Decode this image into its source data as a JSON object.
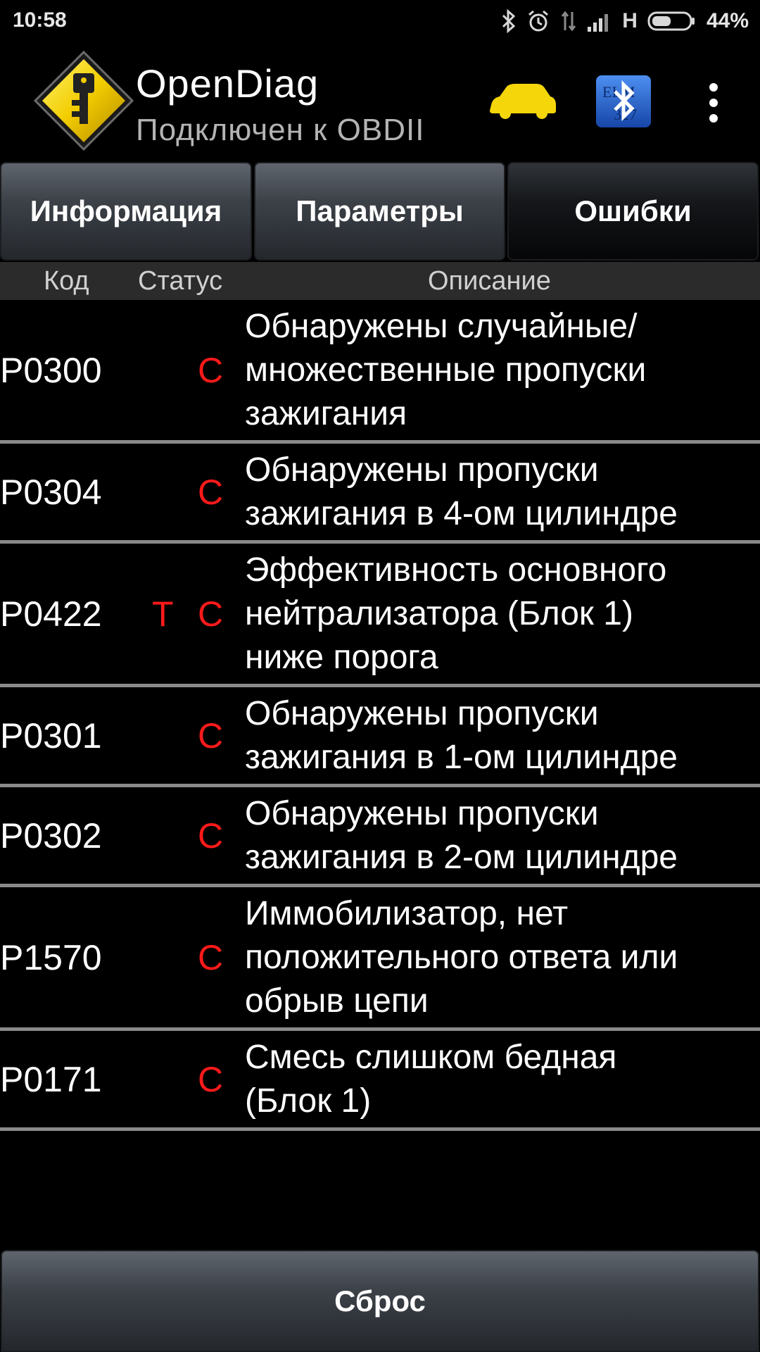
{
  "status_bar": {
    "time": "10:58",
    "network": "H",
    "battery": "44%",
    "icons": [
      "bluetooth-icon",
      "alarm-icon",
      "data-off-icon",
      "signal-icon",
      "battery-icon"
    ]
  },
  "app": {
    "title": "OpenDiag",
    "subtitle": "Подключен к OBDII",
    "logo_icon": "key-diamond-logo-icon",
    "car_icon": "car-icon",
    "adapter_icon": "elm327-bluetooth-icon",
    "elm_text": "ELM",
    "elm_num": "327"
  },
  "tabs": [
    {
      "label": "Информация",
      "active": false
    },
    {
      "label": "Параметры",
      "active": false
    },
    {
      "label": "Ошибки",
      "active": true
    }
  ],
  "table": {
    "headers": {
      "code": "Код",
      "status": "Статус",
      "description": "Описание"
    },
    "rows": [
      {
        "code": "P0300",
        "status_t": "",
        "status_c": "C",
        "description": "Обнаружены случайные/\nмножественные пропуски\nзажигания"
      },
      {
        "code": "P0304",
        "status_t": "",
        "status_c": "C",
        "description": "Обнаружены пропуски\nзажигания в 4-ом цилиндре"
      },
      {
        "code": "P0422",
        "status_t": "T",
        "status_c": "C",
        "description": "Эффективность основного\nнейтрализатора (Блок 1)\nниже порога"
      },
      {
        "code": "P0301",
        "status_t": "",
        "status_c": "C",
        "description": "Обнаружены пропуски\nзажигания в 1-ом цилиндре"
      },
      {
        "code": "P0302",
        "status_t": "",
        "status_c": "C",
        "description": "Обнаружены пропуски\nзажигания в 2-ом цилиндре"
      },
      {
        "code": "P1570",
        "status_t": "",
        "status_c": "C",
        "description": "Иммобилизатор, нет\nположительного ответа или\nобрыв цепи"
      },
      {
        "code": "P0171",
        "status_t": "",
        "status_c": "C",
        "description": "Смесь слишком бедная\n(Блок 1)"
      }
    ]
  },
  "reset_button": {
    "label": "Сброс"
  },
  "colors": {
    "status_red": "#ff1a1a",
    "logo_yellow": "#f2d200",
    "car_yellow": "#f4d60a",
    "bt_blue": "#1e63d6"
  }
}
